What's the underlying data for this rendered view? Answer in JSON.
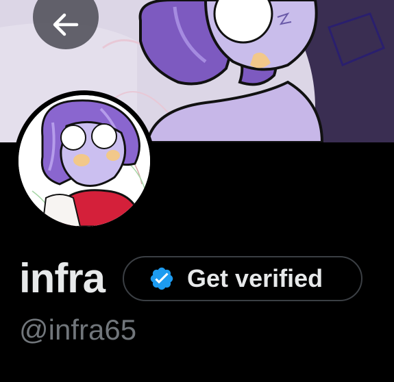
{
  "profile": {
    "display_name": "infra",
    "handle": "@infra65",
    "verify_button_label": "Get verified"
  },
  "icons": {
    "back": "arrow-left-icon",
    "verified": "verified-badge-icon"
  },
  "colors": {
    "background": "#000000",
    "primary_text": "#e7e9ea",
    "secondary_text": "#71767b",
    "verified_badge": "#1d9bf0",
    "button_border": "#3b3f44"
  }
}
